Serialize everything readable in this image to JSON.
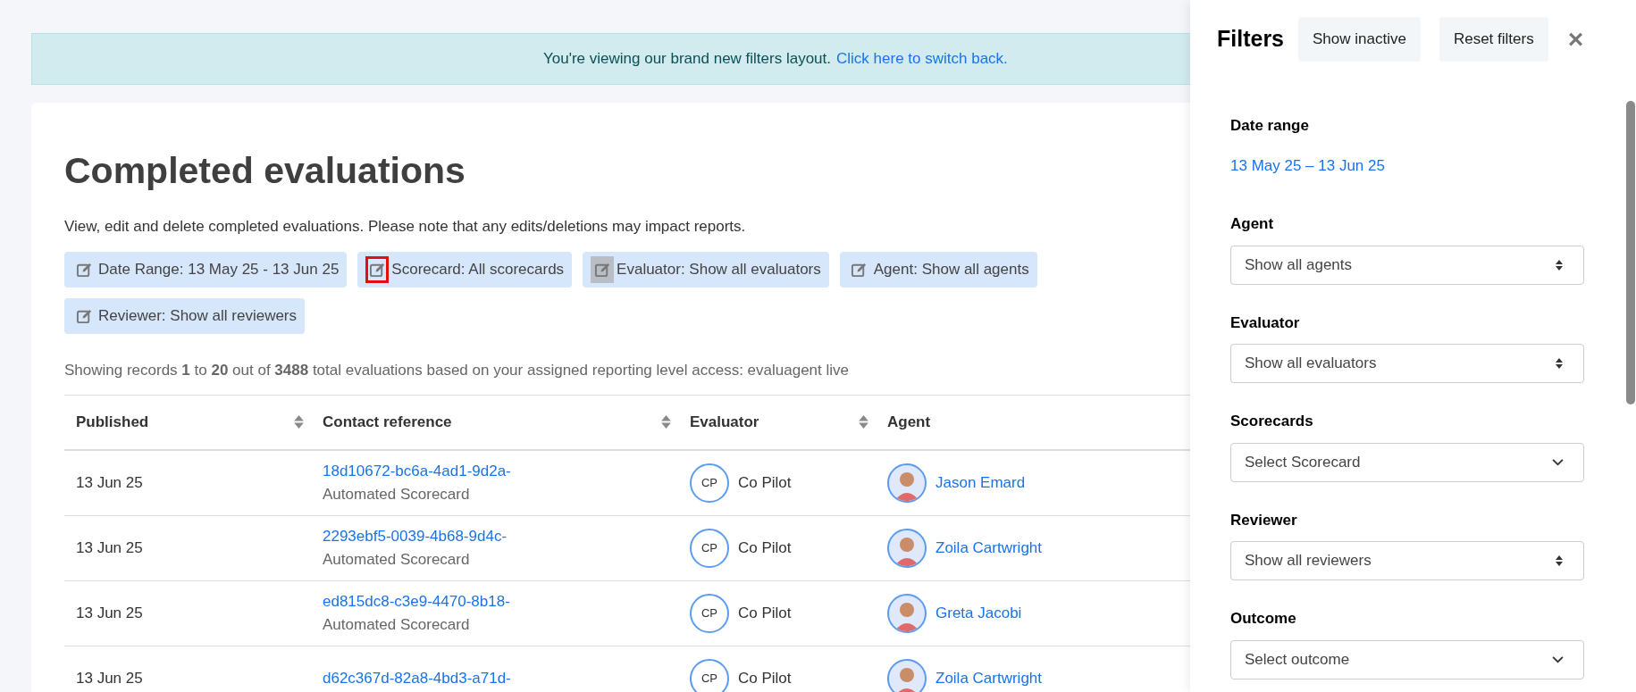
{
  "banner": {
    "text": "You're viewing our brand new filters layout.",
    "link": "Click here to switch back."
  },
  "page": {
    "title": "Completed evaluations",
    "description": "View, edit and delete completed evaluations. Please note that any edits/deletions may impact reports."
  },
  "filter_chips": [
    {
      "label": "Date Range: 13 May 25 - 13 Jun 25",
      "highlighted": false,
      "hovered": false
    },
    {
      "label": "Scorecard: All scorecards",
      "highlighted": true,
      "hovered": false
    },
    {
      "label": "Evaluator: Show all evaluators",
      "highlighted": false,
      "hovered": true
    },
    {
      "label": "Agent: Show all agents",
      "highlighted": false,
      "hovered": false
    },
    {
      "label": "Reviewer: Show all reviewers",
      "highlighted": false,
      "hovered": false
    }
  ],
  "summary": "Showing records **1** to **20** out of **3488** total evaluations based on your assigned reporting level access: evaluagent live",
  "table": {
    "columns": [
      "Published",
      "Contact reference",
      "Evaluator",
      "Agent"
    ],
    "rows": [
      {
        "published": "13 Jun 25",
        "reference": "18d10672-bc6a-4ad1-9d2a-",
        "scorecard": "Automated Scorecard",
        "evaluator_initials": "CP",
        "evaluator": "Co Pilot",
        "agent": "Jason Emard"
      },
      {
        "published": "13 Jun 25",
        "reference": "2293ebf5-0039-4b68-9d4c-",
        "scorecard": "Automated Scorecard",
        "evaluator_initials": "CP",
        "evaluator": "Co Pilot",
        "agent": "Zoila Cartwright"
      },
      {
        "published": "13 Jun 25",
        "reference": "ed815dc8-c3e9-4470-8b18-",
        "scorecard": "Automated Scorecard",
        "evaluator_initials": "CP",
        "evaluator": "Co Pilot",
        "agent": "Greta Jacobi"
      },
      {
        "published": "13 Jun 25",
        "reference": "d62c367d-82a8-4bd3-a71d-",
        "evaluator_initials": "CP",
        "evaluator": "Co Pilot",
        "agent": "Zoila Cartwright"
      }
    ]
  },
  "filters_panel": {
    "title": "Filters",
    "buttons": [
      "Show inactive",
      "Reset filters"
    ],
    "close": "×",
    "sections": [
      {
        "kind": "link",
        "label": "Date range",
        "value": "13 May 25 – 13 Jun 25"
      },
      {
        "kind": "updown",
        "label": "Agent",
        "value": "Show all agents"
      },
      {
        "kind": "updown",
        "label": "Evaluator",
        "value": "Show all evaluators"
      },
      {
        "kind": "dropdown",
        "label": "Scorecards",
        "value": "Select Scorecard"
      },
      {
        "kind": "updown",
        "label": "Reviewer",
        "value": "Show all reviewers"
      },
      {
        "kind": "dropdown",
        "label": "Outcome",
        "value": "Select outcome"
      }
    ]
  }
}
